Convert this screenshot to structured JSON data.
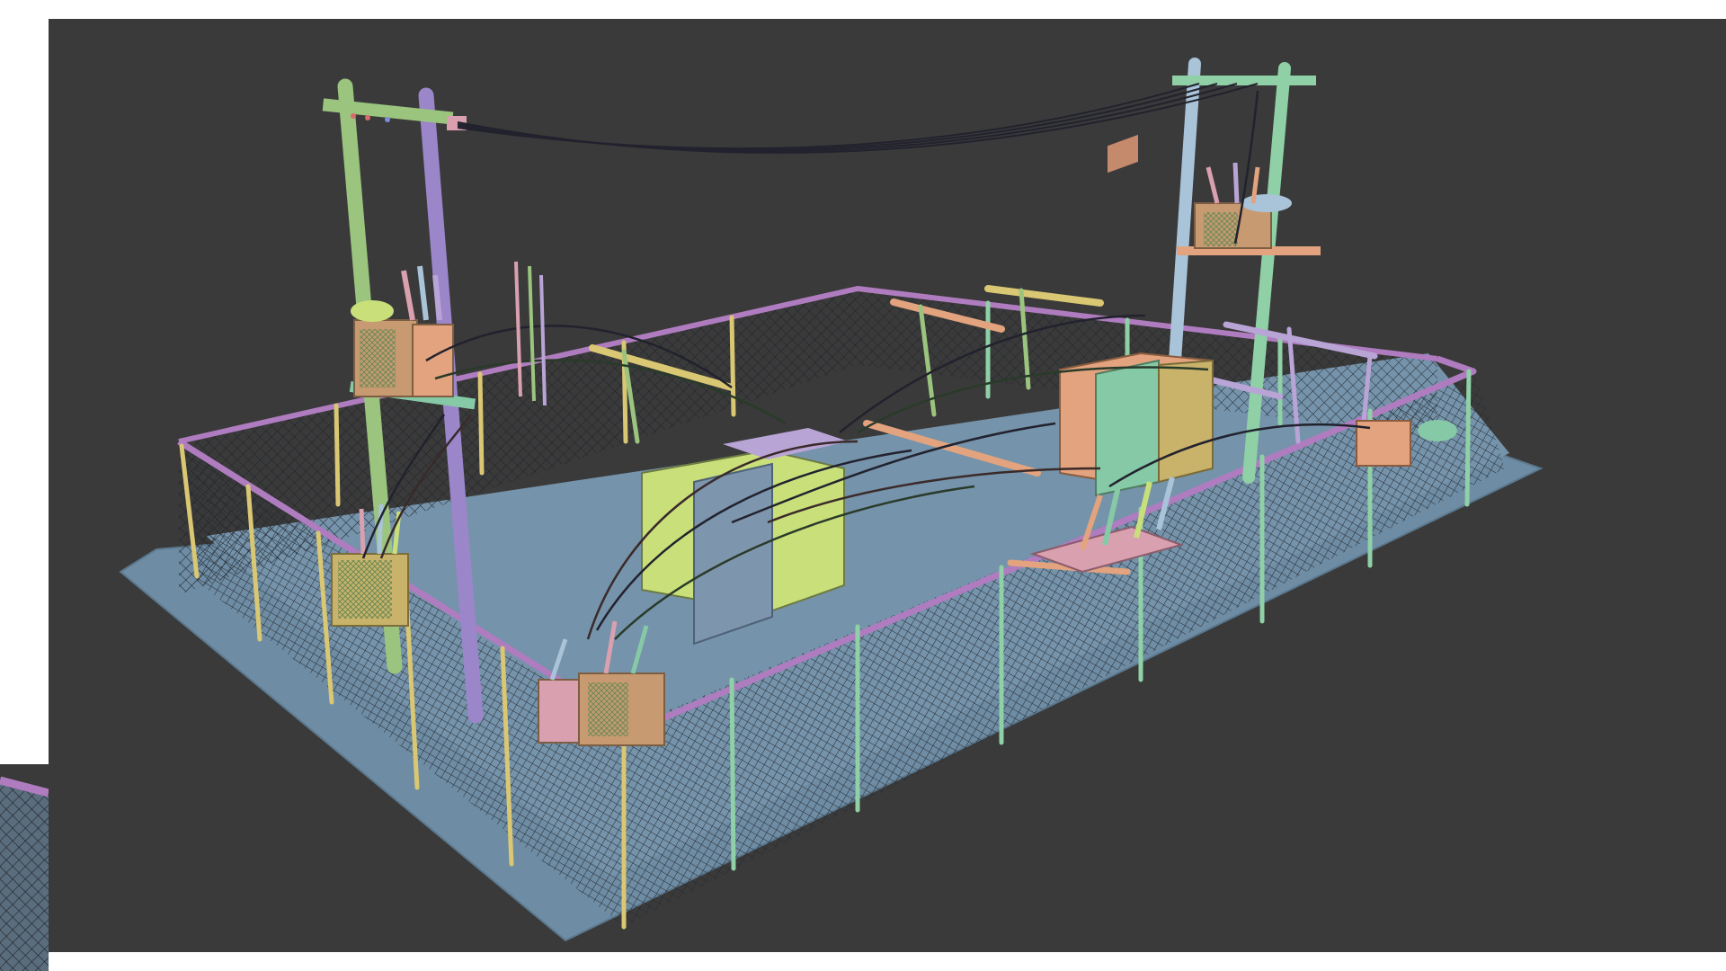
{
  "scene": {
    "background_color": "#3a3a3a",
    "frame_color": "#ffffff",
    "ground_color": "#6e8ca3",
    "fence_rail_color": "#b07cc0",
    "fence_mesh_color": "#2b2f36",
    "pole_colors": [
      "#9bc47e",
      "#9a86c9",
      "#a9c3d9",
      "#d9c773",
      "#8fd0a6"
    ],
    "equipment_colors": [
      "#c9e07a",
      "#b9a4d6",
      "#e2a37e",
      "#86c9a6",
      "#d9a0b0"
    ],
    "wire_color": "#2a2a3a",
    "icon_names": [
      "utility-pole-icon",
      "transformer-icon",
      "switch-cabinet-icon",
      "chain-link-fence-icon"
    ]
  }
}
